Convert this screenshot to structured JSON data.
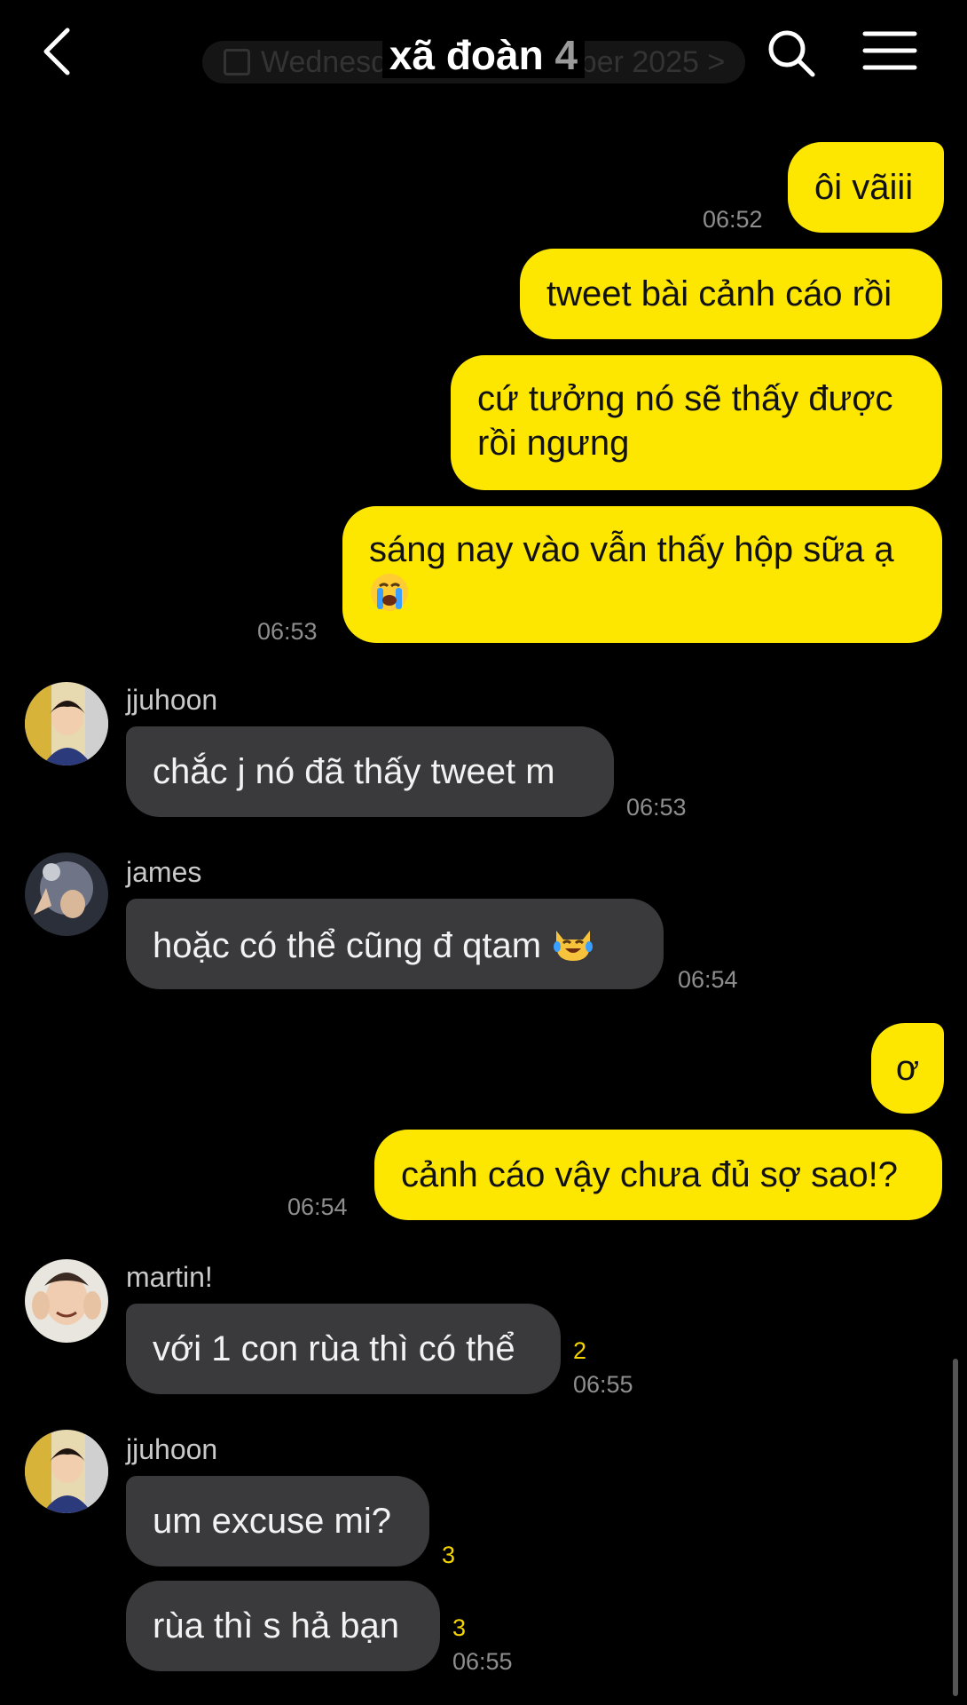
{
  "header": {
    "title": "xã đoàn",
    "member_count": "4",
    "date_chip": "Wednesday, 17 September 2025",
    "back_icon": "chevron-left-icon",
    "search_icon": "search-icon",
    "menu_icon": "hamburger-menu-icon"
  },
  "colors": {
    "my_bubble": "#fde600",
    "their_bubble": "#3a3a3c",
    "unread_count": "#f5d400",
    "background": "#000000"
  },
  "messages": [
    {
      "text": "ôi vãiii",
      "time": "06:52"
    },
    {
      "text": "tweet bài cảnh cáo rồi"
    },
    {
      "text": "cứ tưởng nó sẽ thấy được rồi ngưng"
    },
    {
      "text": "sáng nay vào vẫn thấy hộp sữa ạ",
      "emoji": "crying-face",
      "time": "06:53"
    },
    {
      "sender": "jjuhoon",
      "text": "chắc j nó đã thấy tweet m",
      "time": "06:53"
    },
    {
      "sender": "james",
      "text": "hoặc có thể cũng đ qtam",
      "emoji": "cat-tears-of-joy",
      "time": "06:54"
    },
    {
      "text": "ơ"
    },
    {
      "text": "cảnh cáo vậy chưa đủ sợ sao!?",
      "time": "06:54"
    },
    {
      "sender": "martin!",
      "text": "với 1 con rùa thì có thể",
      "unread": "2",
      "time": "06:55"
    },
    {
      "sender": "jjuhoon",
      "text": "um excuse mi?",
      "unread": "3"
    },
    {
      "text": "rùa thì s hả bạn",
      "unread": "3",
      "time": "06:55"
    }
  ]
}
